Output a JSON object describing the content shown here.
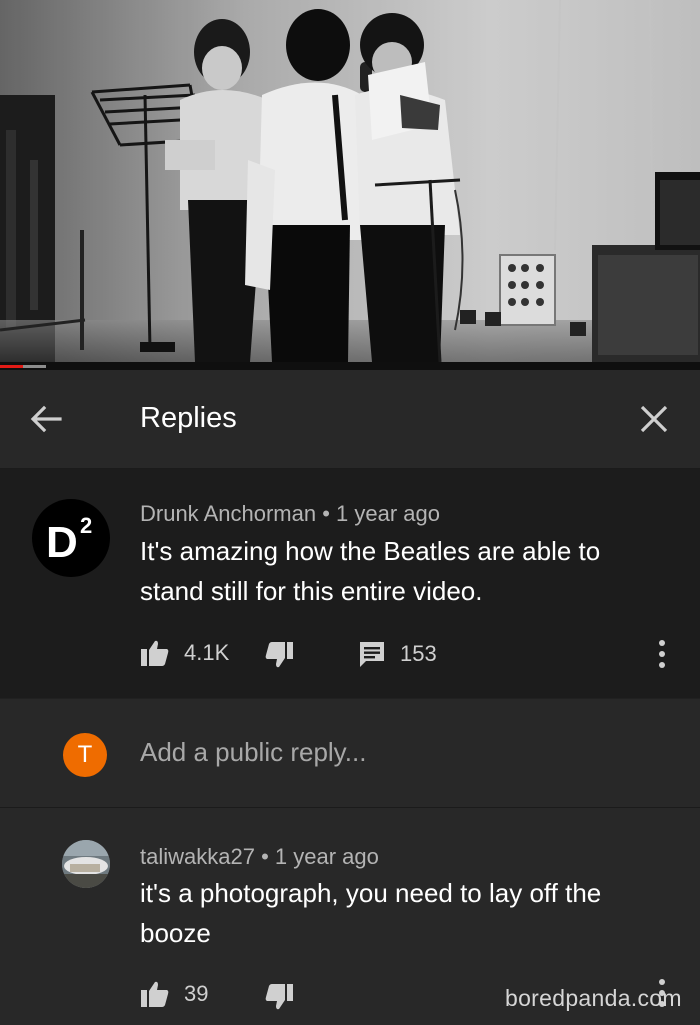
{
  "video": {
    "progress_played": 0.033,
    "progress_buffered": 0.066
  },
  "header": {
    "title": "Replies",
    "back_icon": "arrow-left-icon",
    "close_icon": "close-icon"
  },
  "main_comment": {
    "avatar_text": "D",
    "avatar_superscript": "2",
    "author": "Drunk Anchorman",
    "separator": "•",
    "time": "1 year ago",
    "text_line1": "It's amazing how the Beatles are able to",
    "text_line2": "stand still for this entire video.",
    "likes": "4.1K",
    "replies_count": "153"
  },
  "reply_box": {
    "avatar_letter": "T",
    "avatar_color": "#ef6c00",
    "placeholder": "Add a public reply..."
  },
  "reply_comment": {
    "author": "taliwakka27",
    "separator": "•",
    "time": "1 year ago",
    "text_line1": "it's a photograph, you need to lay off the",
    "text_line2": "booze",
    "likes": "39"
  },
  "watermark": "boredpanda.com",
  "colors": {
    "background": "#212121",
    "header_bg": "#282828",
    "main_comment_bg": "#1c1c1c",
    "progress_played": "#e21b16"
  }
}
